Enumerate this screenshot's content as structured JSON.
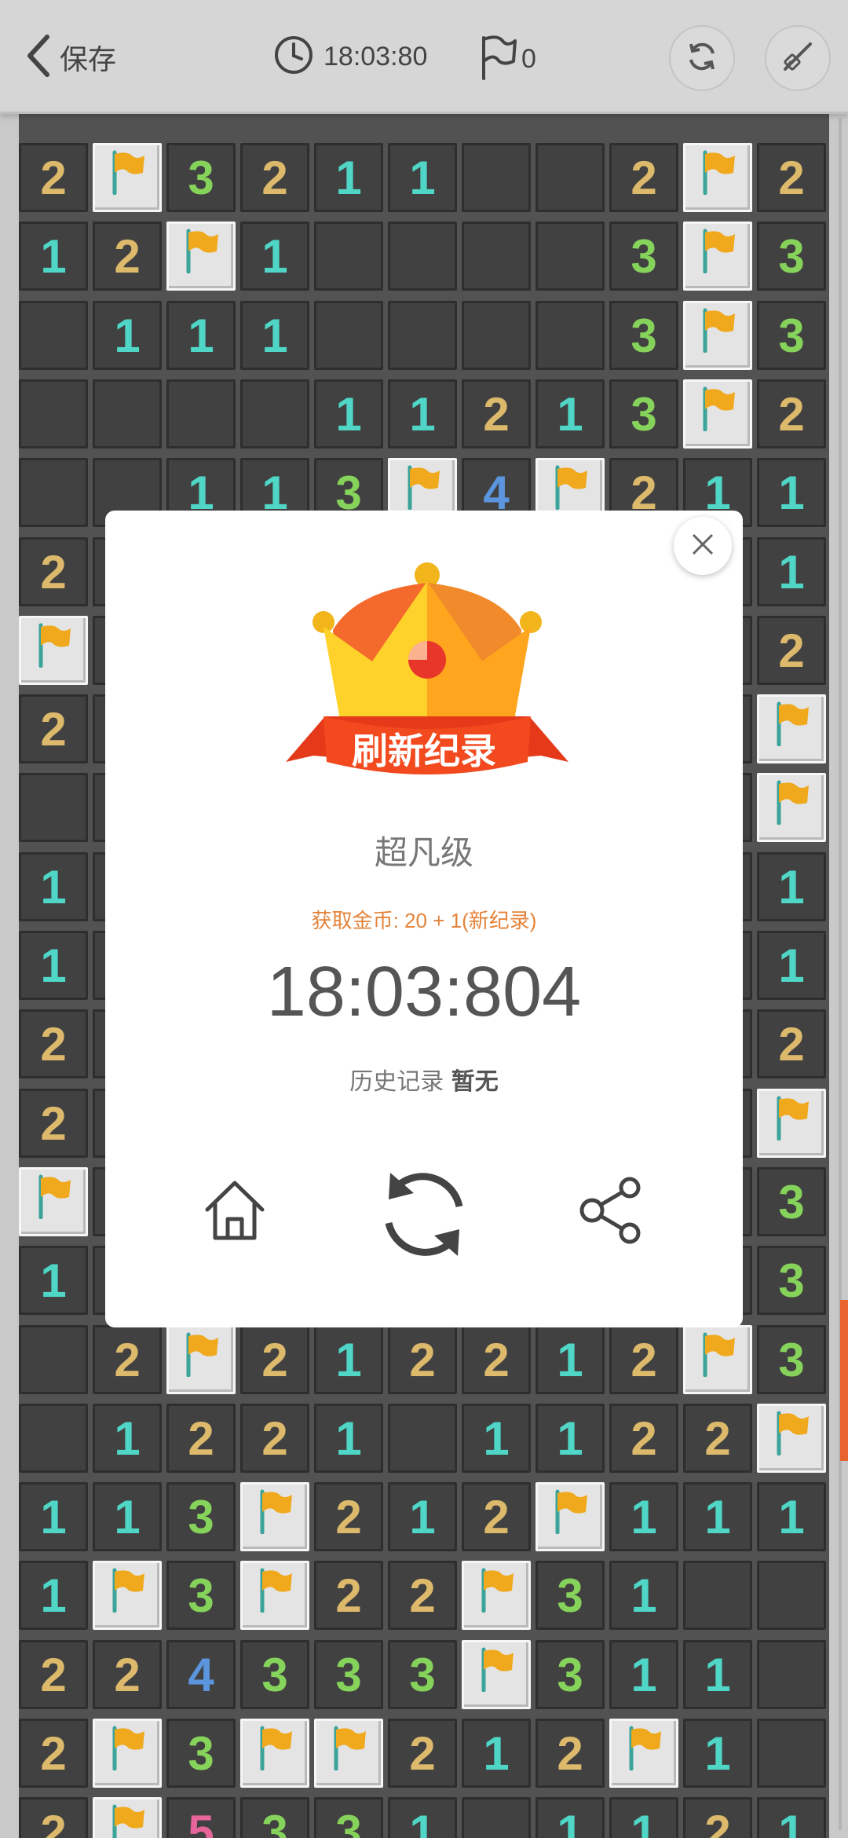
{
  "header": {
    "back_label": "保存",
    "timer": "18:03:80",
    "flag_count": "0",
    "refresh_icon": "refresh-icon",
    "shovel_icon": "shovel-icon"
  },
  "colors": {
    "n1": "#4fd6c6",
    "n2": "#dcb96b",
    "n3": "#86d35b",
    "n4": "#5b95dd",
    "n5": "#e6659b",
    "modal_accent": "#e4833a",
    "banner": "#e83b1c",
    "scroll_indicator": "#e8632d"
  },
  "board": {
    "rows": [
      [
        "2",
        "F",
        "3",
        "2",
        "1",
        "1",
        "",
        "",
        "2",
        "F",
        "2"
      ],
      [
        "1",
        "2",
        "F",
        "1",
        "",
        "",
        "",
        "",
        "3",
        "F",
        "3"
      ],
      [
        "",
        "1",
        "1",
        "1",
        "",
        "",
        "",
        "",
        "3",
        "F",
        "3"
      ],
      [
        "",
        "",
        "",
        "",
        "1",
        "1",
        "2",
        "1",
        "3",
        "F",
        "2"
      ],
      [
        "",
        "",
        "1",
        "1",
        "3",
        "F",
        "4",
        "F",
        "2",
        "1",
        "1"
      ],
      [
        "2",
        "",
        "",
        "",
        "",
        "",
        "",
        "",
        "",
        "",
        "1"
      ],
      [
        "F",
        "",
        "",
        "",
        "",
        "",
        "",
        "",
        "",
        "",
        "2"
      ],
      [
        "2",
        "",
        "",
        "",
        "",
        "",
        "",
        "",
        "",
        "",
        "F"
      ],
      [
        "",
        "",
        "",
        "",
        "",
        "",
        "",
        "",
        "",
        "",
        "F"
      ],
      [
        "1",
        "",
        "",
        "",
        "",
        "",
        "",
        "",
        "",
        "",
        "1"
      ],
      [
        "1",
        "",
        "",
        "",
        "",
        "",
        "",
        "",
        "",
        "",
        "1"
      ],
      [
        "2",
        "",
        "",
        "",
        "",
        "",
        "",
        "",
        "",
        "",
        "2"
      ],
      [
        "2",
        "",
        "",
        "",
        "",
        "",
        "",
        "",
        "",
        "",
        "F"
      ],
      [
        "F",
        "",
        "",
        "",
        "",
        "",
        "",
        "",
        "",
        "",
        "3"
      ],
      [
        "1",
        "",
        "",
        "",
        "",
        "",
        "",
        "",
        "",
        "",
        "3"
      ],
      [
        "",
        "2",
        "F",
        "2",
        "1",
        "2",
        "2",
        "1",
        "2",
        "F",
        "3"
      ],
      [
        "",
        "1",
        "2",
        "2",
        "1",
        "",
        "1",
        "1",
        "2",
        "2",
        "F"
      ],
      [
        "1",
        "1",
        "3",
        "F",
        "2",
        "1",
        "2",
        "F",
        "1",
        "1",
        "1"
      ],
      [
        "1",
        "F",
        "3",
        "F",
        "2",
        "2",
        "F",
        "3",
        "1",
        "",
        ""
      ],
      [
        "2",
        "2",
        "4",
        "3",
        "3",
        "3",
        "F",
        "3",
        "1",
        "1",
        ""
      ],
      [
        "2",
        "F",
        "3",
        "F",
        "F",
        "2",
        "1",
        "2",
        "F",
        "1",
        ""
      ],
      [
        "2",
        "F",
        "5",
        "3",
        "3",
        "1",
        "",
        "1",
        "1",
        "2",
        "1"
      ]
    ]
  },
  "modal": {
    "banner": "刷新纪录",
    "level": "超凡级",
    "reward": "获取金币: 20 + 1(新纪录)",
    "time": "18:03:804",
    "history_label": "历史记录",
    "history_value": "暂无",
    "icons": [
      "home-icon",
      "replay-icon",
      "share-icon",
      "close-icon",
      "crown-icon"
    ]
  }
}
